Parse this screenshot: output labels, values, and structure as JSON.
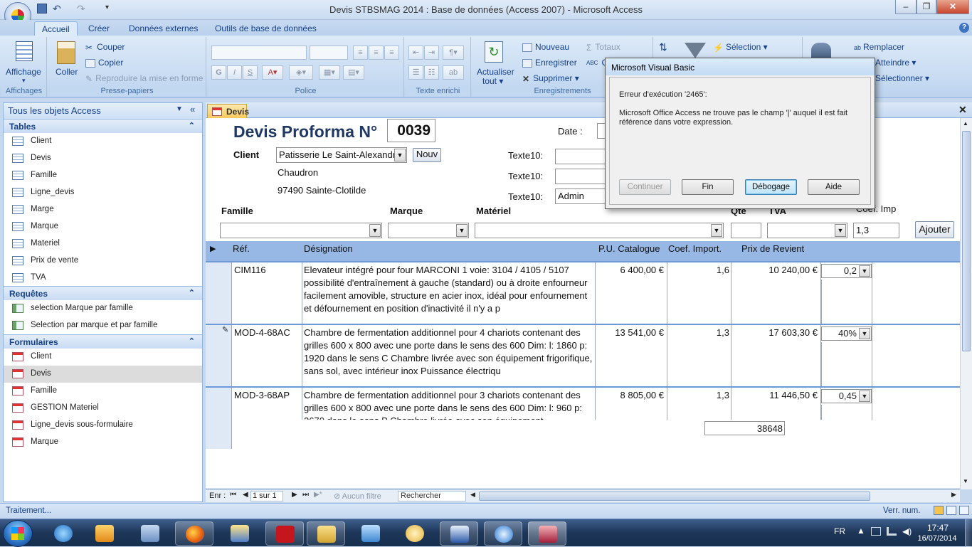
{
  "window": {
    "title": "Devis STBSMAG 2014 : Base de données (Access 2007) - Microsoft Access"
  },
  "ribbon": {
    "tabs": [
      "Accueil",
      "Créer",
      "Données externes",
      "Outils de base de données"
    ],
    "groups": {
      "affichages": {
        "label": "Affichages",
        "affichage": "Affichage"
      },
      "presse": {
        "label": "Presse-papiers",
        "coller": "Coller",
        "couper": "Couper",
        "copier": "Copier",
        "reproduire": "Reproduire la mise en forme"
      },
      "police": {
        "label": "Police",
        "bold": "G",
        "italic": "I",
        "underline": "S"
      },
      "texte": {
        "label": "Texte enrichi"
      },
      "enregistrements": {
        "label": "Enregistrements",
        "actualiser": "Actualiser",
        "tout": "tout",
        "nouveau": "Nouveau",
        "enregistrer": "Enregistrer",
        "supprimer": "Supprimer",
        "totaux": "Totaux",
        "orth": "O"
      },
      "trier": {
        "selection": "Sélection"
      },
      "rechercher": {
        "remplacer": "Remplacer",
        "atteindre": "Atteindre",
        "selectionner": "Sélectionner"
      }
    }
  },
  "nav": {
    "header": "Tous les objets Access",
    "tables_title": "Tables",
    "tables": [
      "Client",
      "Devis",
      "Famille",
      "Ligne_devis",
      "Marge",
      "Marque",
      "Materiel",
      "Prix de vente",
      "TVA"
    ],
    "queries_title": "Requêtes",
    "queries": [
      "selection Marque par famille",
      "Selection par marque et par famille"
    ],
    "forms_title": "Formulaires",
    "forms": [
      "Client",
      "Devis",
      "Famille",
      "GESTION Materiel",
      "Ligne_devis sous-formulaire",
      "Marque"
    ]
  },
  "doc": {
    "tab": "Devis",
    "title": "Devis Proforma N°",
    "numero": "0039",
    "date_label": "Date :",
    "client_label": "Client",
    "client_value": "Patisserie Le Saint-Alexandre",
    "nouv_button": "Nouv",
    "addr1": "Chaudron",
    "addr2": "97490 Sainte-Clotilde",
    "texte10_1": "Texte10:",
    "texte10_2": "Texte10:",
    "texte10_3": "Texte10:",
    "texte10_value": "Admin",
    "famille_label": "Famille",
    "marque_label": "Marque",
    "materiel_label": "Matériel",
    "qte_label": "Qte",
    "tva_label": "TVA",
    "coef_label": "Coef. Imp",
    "coef_value": "1,3",
    "ajouter_button": "Ajouter",
    "grid": {
      "headers": [
        "Réf.",
        "Désignation",
        "P.U. Catalogue",
        "Coef. Import.",
        "Prix de Revient"
      ],
      "rows": [
        {
          "ref": "CIM116",
          "designation": "Elevateur intégré pour four MARCONI 1 voie: 3104 / 4105 / 5107 possibilité d'entraînement à gauche (standard) ou à droite enfourneur facilement amovible, structure en acier inox, idéal pour enfournement et défournement  en position d'inactivité il n'y a p",
          "pu": "6 400,00 €",
          "coef": "1,6",
          "revient": "10 240,00 €",
          "marge": "0,2"
        },
        {
          "ref": "MOD-4-68AC",
          "designation": "Chambre de fermentation additionnel pour 4 chariots contenant des grilles 600 x 800 avec une porte dans le sens des 600  Dim: l: 1860 p: 1920 dans le sens C Chambre livrée avec son équipement frigorifique, sans sol, avec intérieur inox Puissance électriqu",
          "pu": "13 541,00 €",
          "coef": "1,3",
          "revient": "17 603,30 €",
          "marge": "40%"
        },
        {
          "ref": "MOD-3-68AP",
          "designation": "Chambre de fermentation additionnel pour 3 chariots contenant des grilles 600 x 800 avec une porte dans le sens des 600  Dim: l: 960 p: 2670 dans le sens P Chambre livrée avec son équipement",
          "pu": "8 805,00 €",
          "coef": "1,3",
          "revient": "11 446,50 €",
          "marge": "0,45"
        }
      ],
      "total": "38648"
    },
    "recnav": {
      "label": "Enr :",
      "position": "1 sur 1",
      "filter": "Aucun filtre",
      "search": "Rechercher"
    }
  },
  "dialog": {
    "title": "Microsoft Visual Basic",
    "error": "Erreur d'exécution '2465':",
    "message": "Microsoft Office Access ne trouve pas le champ '|' auquel il est fait référence dans votre expression.",
    "buttons": {
      "continuer": "Continuer",
      "fin": "Fin",
      "debogage": "Débogage",
      "aide": "Aide"
    }
  },
  "status": {
    "left": "Traitement...",
    "right": "Verr. num."
  },
  "taskbar": {
    "lang": "FR",
    "time": "17:47",
    "date": "16/07/2014"
  }
}
